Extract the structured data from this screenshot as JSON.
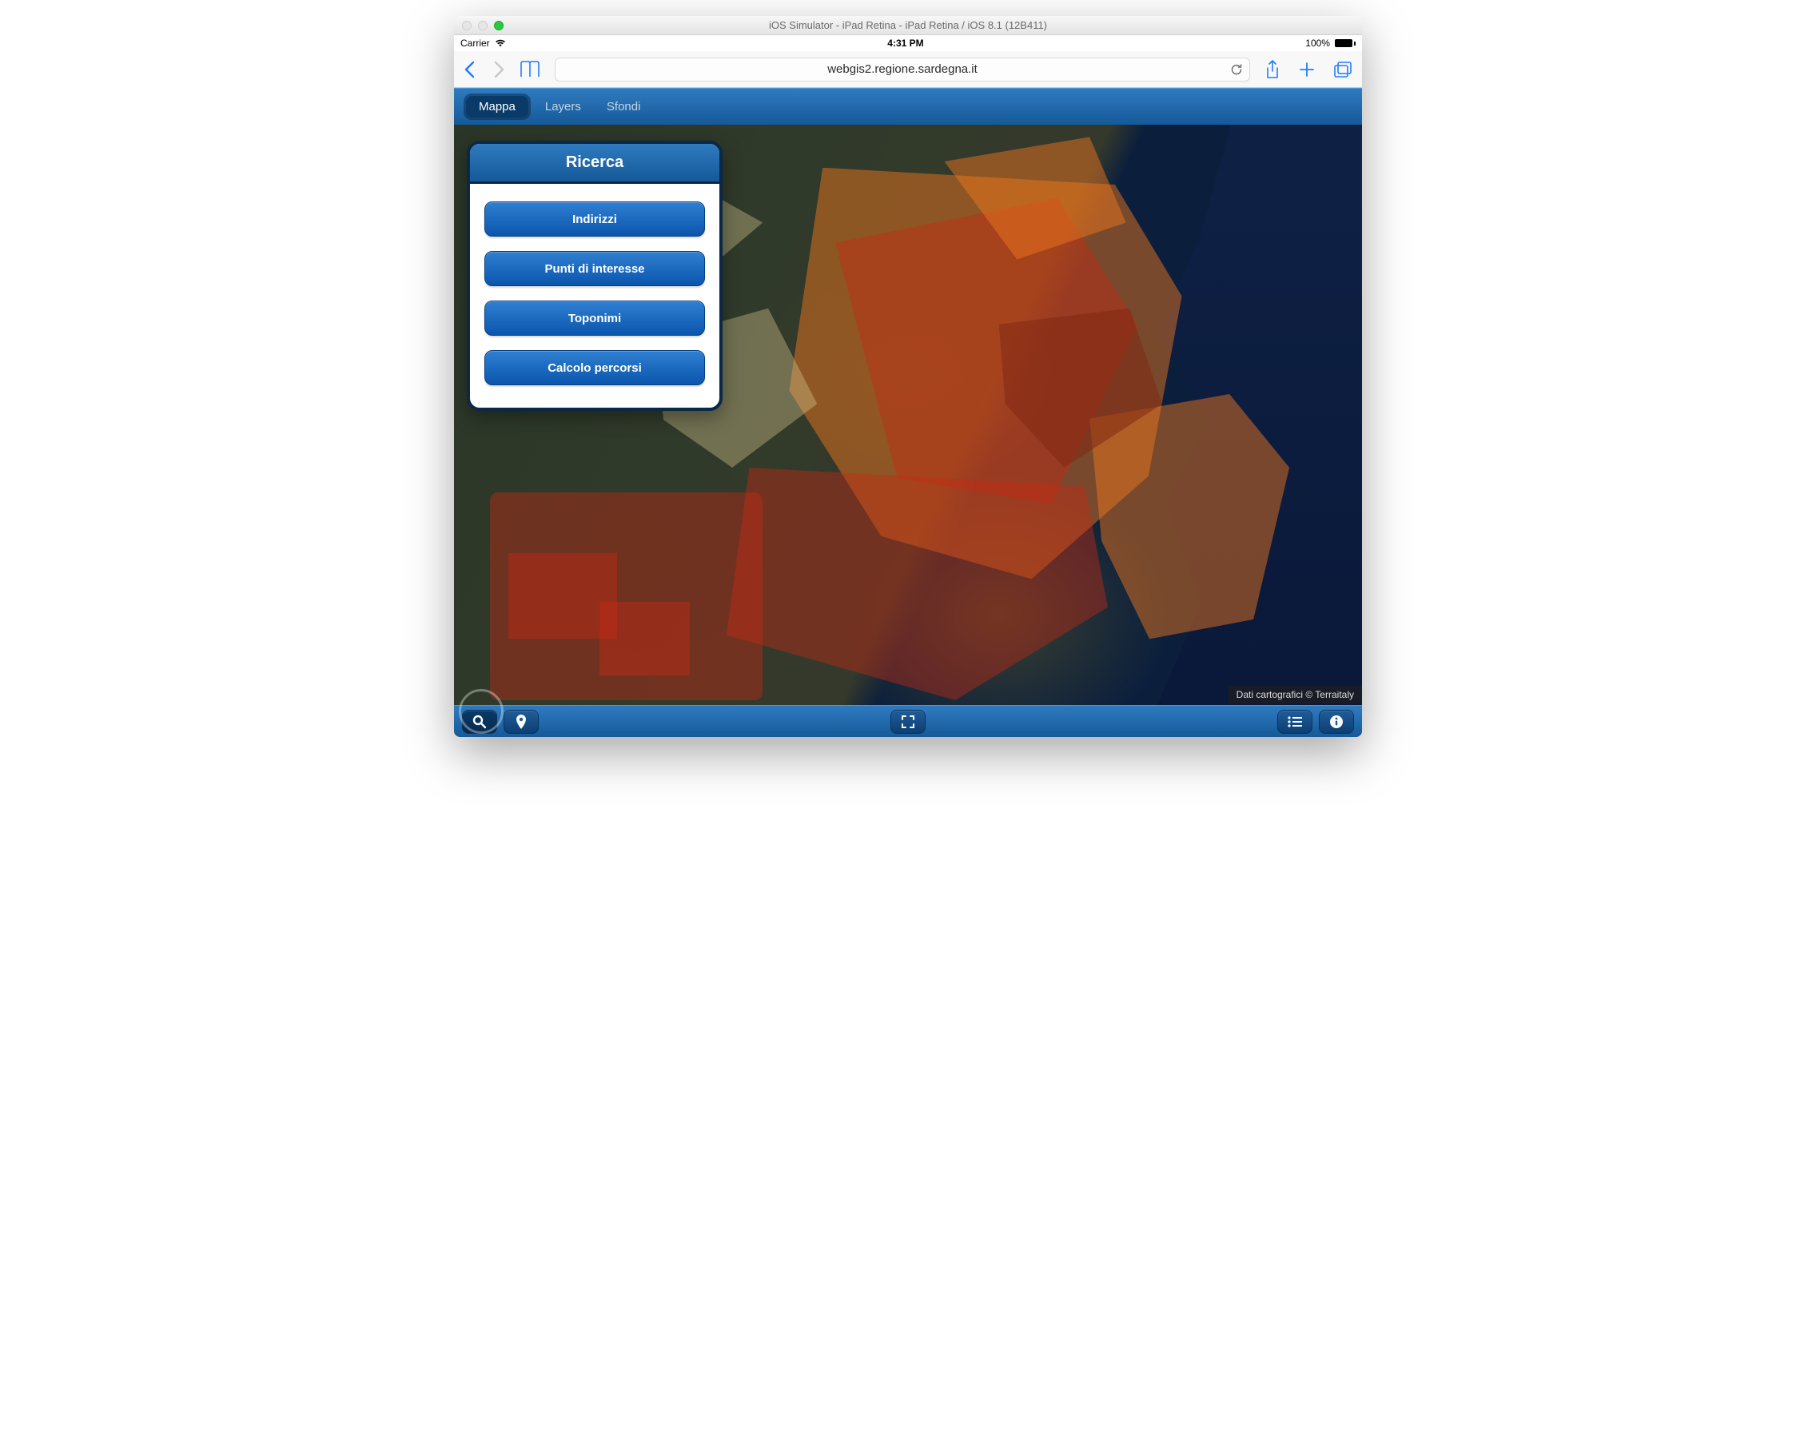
{
  "mac": {
    "title": "iOS Simulator - iPad Retina - iPad Retina / iOS 8.1 (12B411)"
  },
  "status": {
    "carrier": "Carrier",
    "time": "4:31 PM",
    "battery": "100%"
  },
  "safari": {
    "url": "webgis2.regione.sardegna.it"
  },
  "topbar": {
    "tabs": [
      {
        "label": "Mappa",
        "active": true
      },
      {
        "label": "Layers",
        "active": false
      },
      {
        "label": "Sfondi",
        "active": false
      }
    ]
  },
  "searchPanel": {
    "title": "Ricerca",
    "buttons": [
      {
        "label": "Indirizzi"
      },
      {
        "label": "Punti di interesse"
      },
      {
        "label": "Toponimi"
      },
      {
        "label": "Calcolo percorsi"
      }
    ]
  },
  "attribution": "Dati cartografici © Terraitaly",
  "bottombar": {
    "search_active": true
  }
}
